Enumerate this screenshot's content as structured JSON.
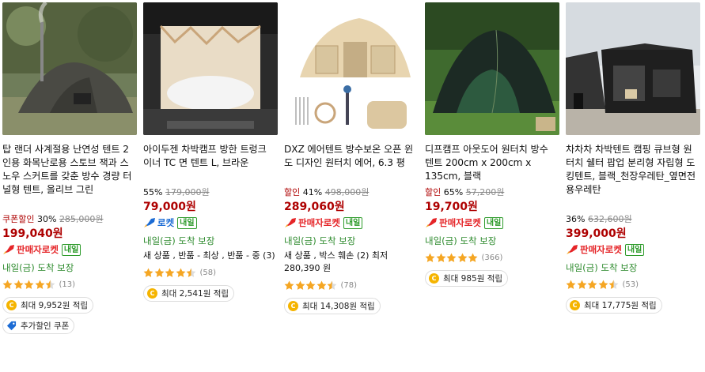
{
  "products": [
    {
      "title": "탑 랜더 사계절용 난연성 텐트 2인용 화목난로용 스토브 잭과 스노우 스커트를 갖춘 방수 경량 터널형 텐트, 올리브 그린",
      "discount_label": "쿠폰할인",
      "discount_pct": "30%",
      "original_price": "285,000원",
      "price": "199,040원",
      "badge": "판매자로켓",
      "badge_tag": "내일",
      "arrival": "내일(금) 도착 보장",
      "extra": "",
      "rating": 4.5,
      "review_count": "(13)",
      "reward": "최대 9,952원 적립",
      "coupon": "추가할인 쿠폰"
    },
    {
      "title": "아이두젠 차박캠프 방한 트렁크 이너 TC 면 텐트 L, 브라운",
      "discount_label": "",
      "discount_pct": "55%",
      "original_price": "179,000원",
      "price": "79,000원",
      "badge": "로켓",
      "badge_tag": "내일",
      "arrival": "내일(금) 도착 보장",
      "extra": "새 상품 , 반품 - 최상 , 반품 - 중 (3)",
      "rating": 4.5,
      "review_count": "(58)",
      "reward": "최대 2,541원 적립",
      "coupon": ""
    },
    {
      "title": "DXZ 에어텐트 방수보온 오픈 윈도 디자인 원터치 에어, 6.3 평",
      "discount_label": "할인",
      "discount_pct": "41%",
      "original_price": "498,000원",
      "price": "289,060원",
      "badge": "판매자로켓",
      "badge_tag": "내일",
      "arrival": "내일(금) 도착 보장",
      "extra": "새 상품 , 박스 훼손 (2) 최저 280,390 원",
      "rating": 4.5,
      "review_count": "(78)",
      "reward": "최대 14,308원 적립",
      "coupon": ""
    },
    {
      "title": "디프캠프 아웃도어 원터치 방수 텐트 200cm x 200cm x 135cm, 블랙",
      "discount_label": "할인",
      "discount_pct": "65%",
      "original_price": "57,200원",
      "price": "19,700원",
      "badge": "판매자로켓",
      "badge_tag": "내일",
      "arrival": "내일(금) 도착 보장",
      "extra": "",
      "rating": 5,
      "review_count": "(366)",
      "reward": "최대 985원 적립",
      "coupon": ""
    },
    {
      "title": "차차차 차박텐트 캠핑 큐브형 원터치 쉘터 팝업 분리형 자립형 도킹텐트, 블랙_천장우레탄_옆면전용우레탄",
      "discount_label": "",
      "discount_pct": "36%",
      "original_price": "632,600원",
      "price": "399,000원",
      "badge": "판매자로켓",
      "badge_tag": "내일",
      "arrival": "내일(금) 도착 보장",
      "extra": "",
      "rating": 4.5,
      "review_count": "(53)",
      "reward": "최대 17,775원 적립",
      "coupon": ""
    }
  ],
  "colors": {
    "price": "#ae0000",
    "arrival": "#2e8b2e",
    "star": "#f5a623",
    "seller_rocket": "#e52528",
    "rocket": "#1b6bd4",
    "coin": "#f5b400"
  },
  "icons": [
    "rocket-icon",
    "star-icon",
    "coin-icon",
    "coupon-tag-icon"
  ]
}
